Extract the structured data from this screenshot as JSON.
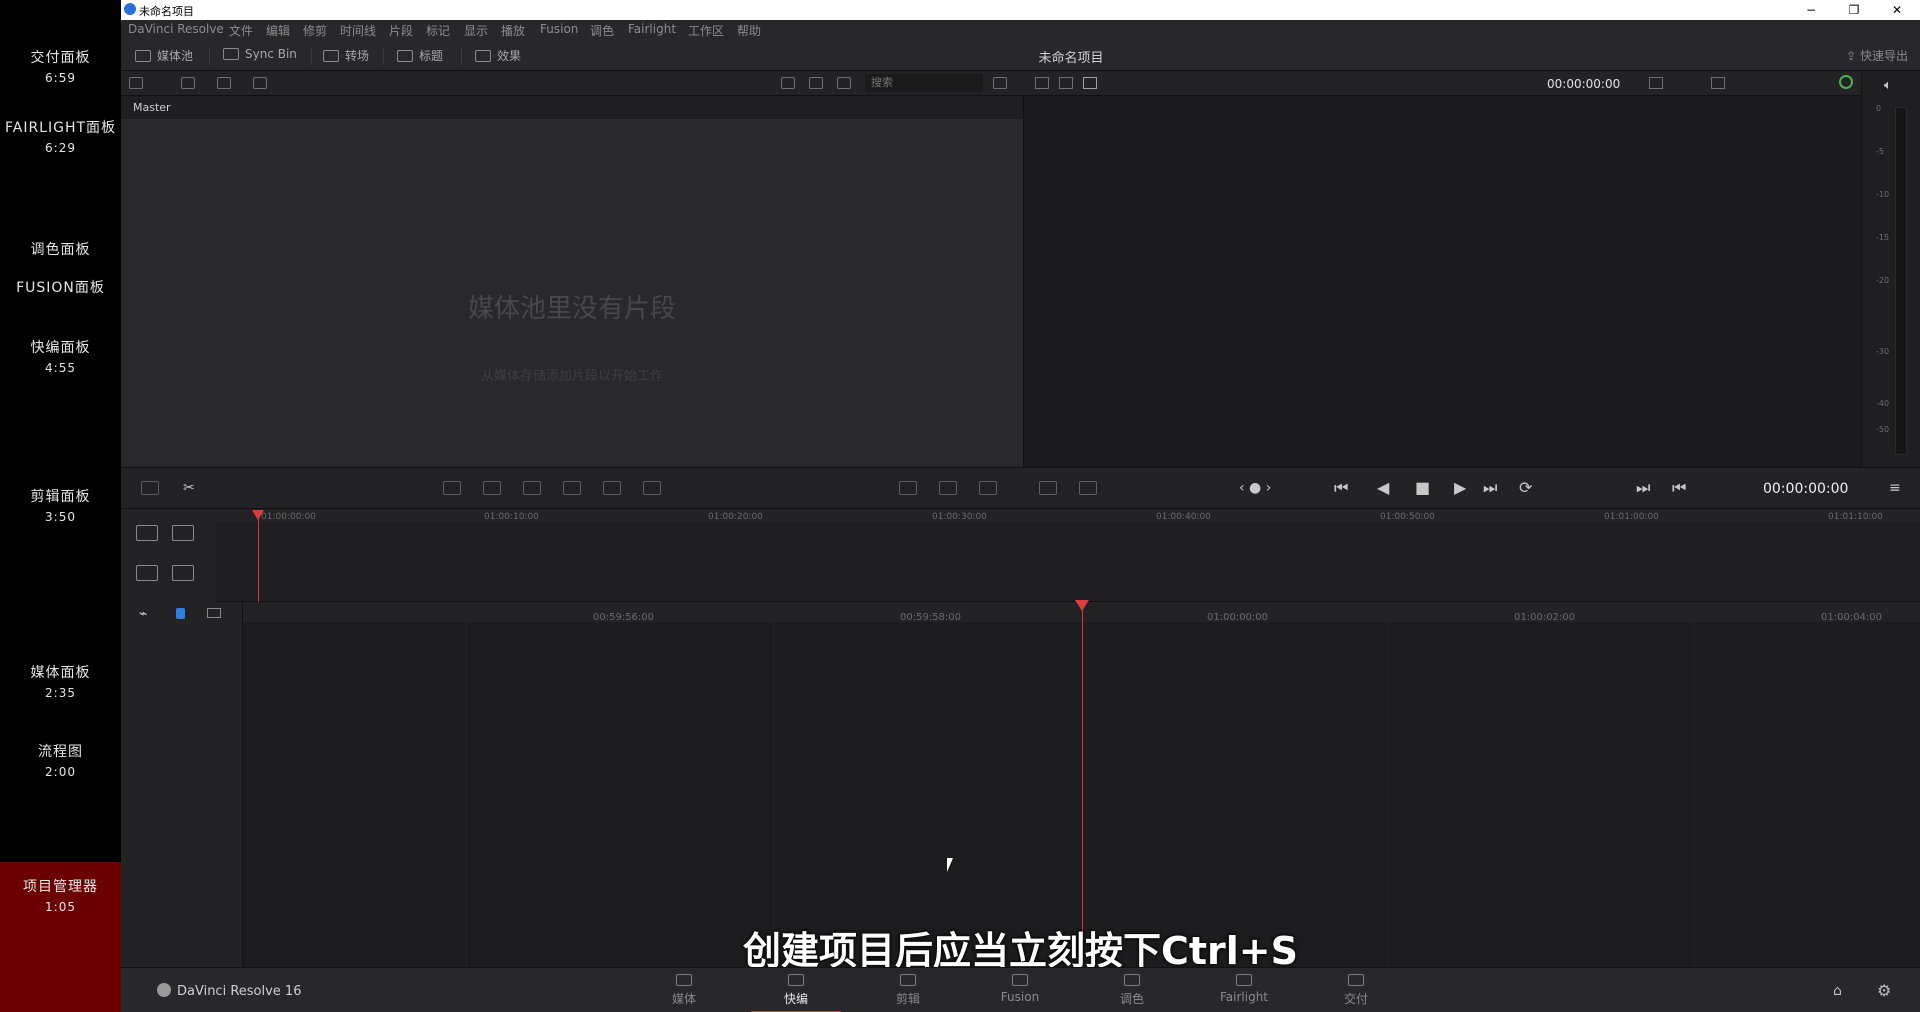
{
  "chapters": [
    {
      "name": "交付面板",
      "time": "6:59"
    },
    {
      "name": "FAIRLIGHT面板",
      "time": "6:29"
    },
    {
      "name": "调色面板",
      "time": ""
    },
    {
      "name": "FUSION面板",
      "time": ""
    },
    {
      "name": "快编面板",
      "time": "4:55"
    },
    {
      "name": "剪辑面板",
      "time": "3:50"
    },
    {
      "name": "媒体面板",
      "time": "2:35"
    },
    {
      "name": "流程图",
      "time": "2:00"
    },
    {
      "name": "项目管理器",
      "time": "1:05"
    }
  ],
  "window": {
    "title": "未命名项目",
    "minimize": "−",
    "restore": "❐",
    "close": "✕"
  },
  "menu": [
    "DaVinci Resolve",
    "文件",
    "编辑",
    "修剪",
    "时间线",
    "片段",
    "标记",
    "显示",
    "播放",
    "Fusion",
    "调色",
    "Fairlight",
    "工作区",
    "帮助"
  ],
  "toolbar": {
    "media_pool": "媒体池",
    "sync_bin": "Sync Bin",
    "transitions": "转场",
    "titles": "标题",
    "effects": "效果",
    "project_title": "未命名项目",
    "quick_export": "快速导出"
  },
  "media_pool": {
    "search_placeholder": "搜索",
    "bin": "Master",
    "empty_title": "媒体池里没有片段",
    "empty_hint": "从媒体存储添加片段以开始工作"
  },
  "viewer": {
    "timecode": "00:00:00:00"
  },
  "meter_labels": [
    "0",
    "-5",
    "-10",
    "-15",
    "-20",
    "-30",
    "-40",
    "-50"
  ],
  "transport": {
    "timecode": "00:00:00:00"
  },
  "upper_ruler": [
    "01:00:00:00",
    "01:00:10:00",
    "01:00:20:00",
    "01:00:30:00",
    "01:00:40:00",
    "01:00:50:00",
    "01:01:00:00",
    "01:01:10:00"
  ],
  "lower_ruler": [
    "00:59:56:00",
    "00:59:58:00",
    "01:00:00:00",
    "01:00:02:00",
    "01:00:04:00"
  ],
  "subtitle": "创建项目后应当立刻按下Ctrl+S",
  "bottom": {
    "brand": "DaVinci Resolve 16",
    "pages": [
      "媒体",
      "快编",
      "剪辑",
      "Fusion",
      "调色",
      "Fairlight",
      "交付"
    ],
    "active_page": "快编"
  }
}
